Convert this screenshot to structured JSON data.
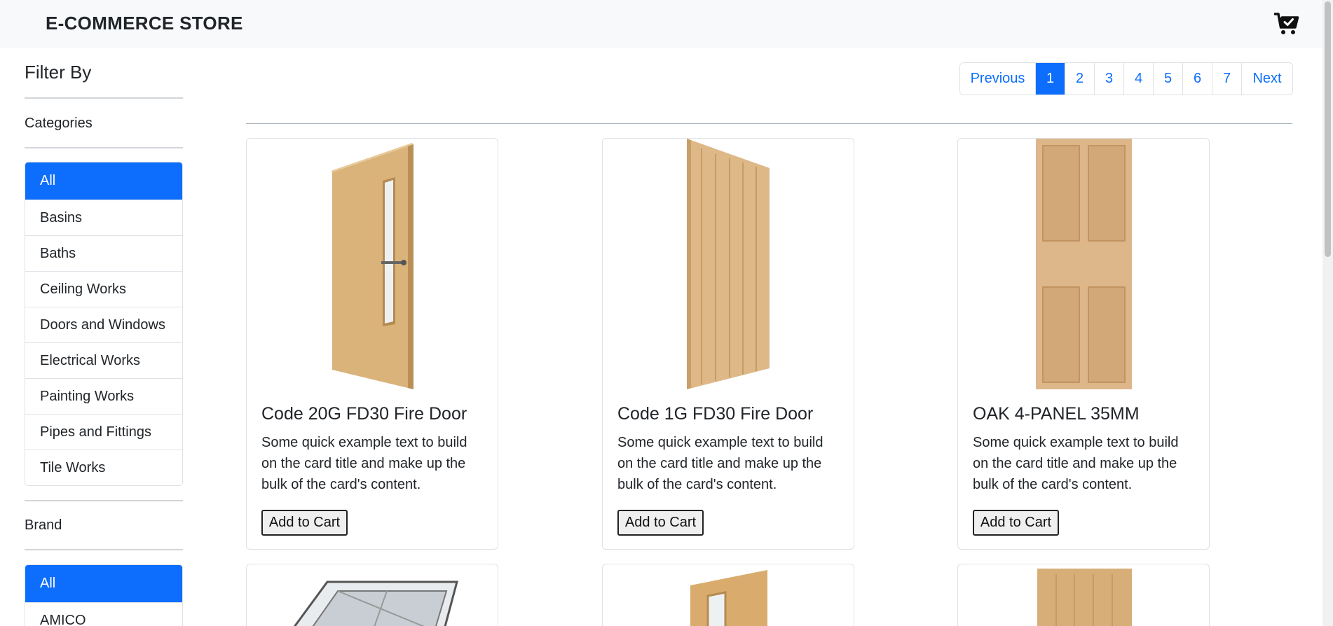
{
  "navbar": {
    "brand": "E-COMMERCE STORE",
    "cart_icon": "cart-check-icon"
  },
  "sidebar": {
    "title": "Filter By",
    "categories": {
      "title": "Categories",
      "items": [
        "All",
        "Basins",
        "Baths",
        "Ceiling Works",
        "Doors and Windows",
        "Electrical Works",
        "Painting Works",
        "Pipes and Fittings",
        "Tile Works"
      ],
      "active": "All"
    },
    "brand": {
      "title": "Brand",
      "items": [
        "All",
        "AMICO"
      ],
      "active": "All"
    }
  },
  "pagination": {
    "previous": "Previous",
    "pages": [
      "1",
      "2",
      "3",
      "4",
      "5",
      "6",
      "7"
    ],
    "current": "1",
    "next": "Next"
  },
  "products": [
    {
      "title": "Code 20G FD30 Fire Door",
      "text": "Some quick example text to build on the card title and make up the bulk of the card's content.",
      "button": "Add to Cart",
      "image": "oak-door-glazed-image"
    },
    {
      "title": "Code 1G FD30 Fire Door",
      "text": "Some quick example text to build on the card title and make up the bulk of the card's content.",
      "button": "Add to Cart",
      "image": "oak-door-vertical-panels-image"
    },
    {
      "title": "OAK 4-PANEL 35MM",
      "text": "Some quick example text to build on the card title and make up the bulk of the card's content.",
      "button": "Add to Cart",
      "image": "oak-four-panel-door-image"
    }
  ],
  "products_partial": [
    {
      "image": "roof-window-image"
    },
    {
      "image": "oak-glazed-door-image"
    },
    {
      "image": "oak-panel-door-image"
    }
  ],
  "colors": {
    "primary": "#0d6efd",
    "navbar_bg": "#f8f9fa",
    "text": "#212529",
    "door_oak": "#d9b37a"
  }
}
